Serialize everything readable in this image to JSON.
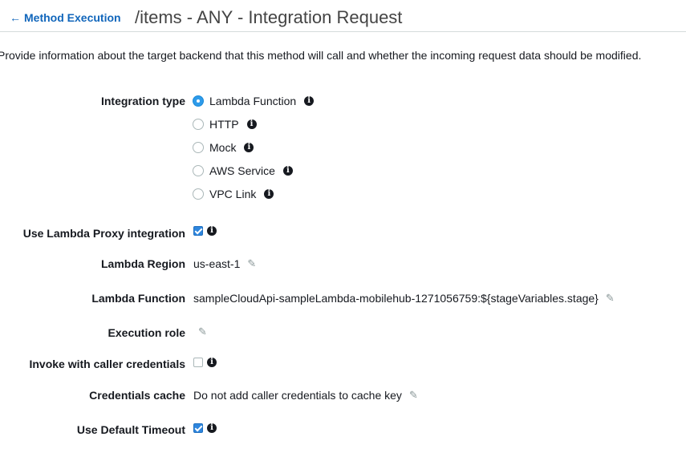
{
  "header": {
    "back_label": "Method Execution",
    "title": "/items - ANY - Integration Request"
  },
  "description": "Provide information about the target backend that this method will call and whether the incoming request data should be modified.",
  "integration_type": {
    "label": "Integration type",
    "options": [
      {
        "label": "Lambda Function",
        "selected": true
      },
      {
        "label": "HTTP",
        "selected": false
      },
      {
        "label": "Mock",
        "selected": false
      },
      {
        "label": "AWS Service",
        "selected": false
      },
      {
        "label": "VPC Link",
        "selected": false
      }
    ]
  },
  "proxy": {
    "label": "Use Lambda Proxy integration",
    "checked": true
  },
  "region": {
    "label": "Lambda Region",
    "value": "us-east-1"
  },
  "function": {
    "label": "Lambda Function",
    "value": "sampleCloudApi-sampleLambda-mobilehub-1271056759:${stageVariables.stage}"
  },
  "role": {
    "label": "Execution role",
    "value": ""
  },
  "caller_credentials": {
    "label": "Invoke with caller credentials",
    "checked": false
  },
  "credentials_cache": {
    "label": "Credentials cache",
    "value": "Do not add caller credentials to cache key"
  },
  "default_timeout": {
    "label": "Use Default Timeout",
    "checked": true
  },
  "colors": {
    "link": "#1166bb",
    "accent": "#2e86de"
  },
  "icons": {
    "back": "arrow-left-icon",
    "info": "info-icon",
    "edit": "pencil-icon"
  }
}
